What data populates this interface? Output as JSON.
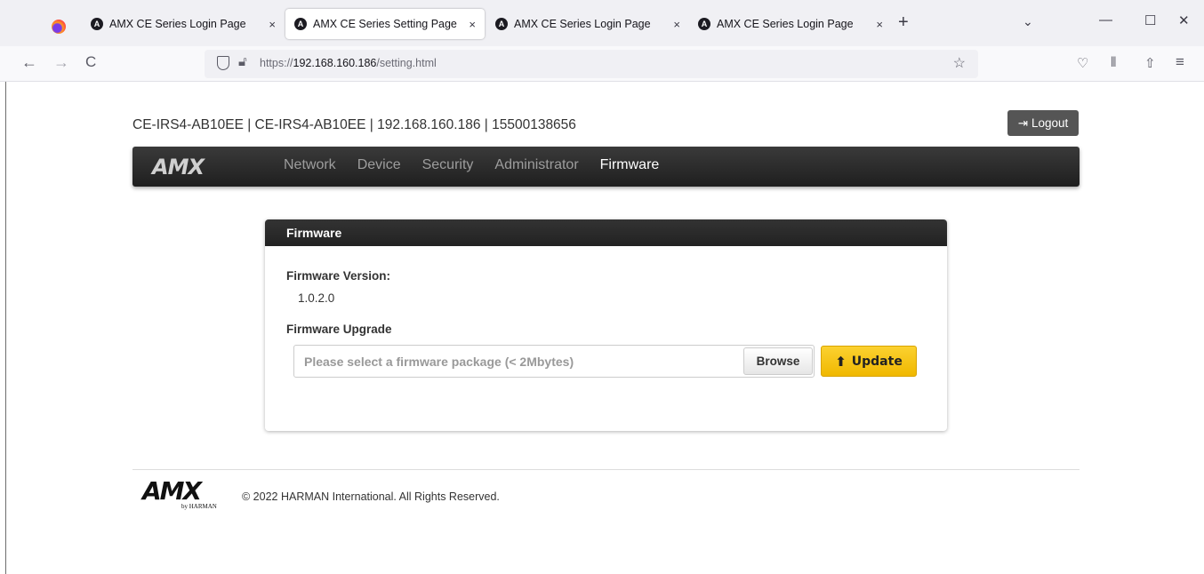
{
  "browser": {
    "tabs": [
      {
        "label": "AMX CE Series Login Page",
        "close": "×"
      },
      {
        "label": "AMX CE Series Setting Page",
        "close": "×"
      },
      {
        "label": "AMX CE Series Login Page",
        "close": "×"
      },
      {
        "label": "AMX CE Series Login Page",
        "close": "×"
      }
    ],
    "new_tab": "+",
    "tab_list": "⌄",
    "window_controls": {
      "minimize": "—",
      "maximize": "☐",
      "close": "✕"
    },
    "nav": {
      "back": "←",
      "forward": "→",
      "reload": "C"
    },
    "url_prefix": "https://",
    "url_host": "192.168.160.186",
    "url_path": "/setting.html",
    "star": "☆",
    "toolbar_icons": {
      "pocket": "♡",
      "library": "⫴",
      "share": "⇧",
      "menu": "≡"
    }
  },
  "header": {
    "device_info": "CE-IRS4-AB10EE | CE-IRS4-AB10EE | 192.168.160.186 | 15500138656",
    "logout_label": "Logout",
    "logout_icon": "⇥"
  },
  "nav": {
    "brand": "AMX",
    "items": [
      "Network",
      "Device",
      "Security",
      "Administrator",
      "Firmware"
    ],
    "active": "Firmware"
  },
  "panel": {
    "title": "Firmware",
    "version_label": "Firmware Version:",
    "version_value": "1.0.2.0",
    "upgrade_label": "Firmware Upgrade",
    "file_placeholder": "Please select a firmware package (< 2Mbytes)",
    "browse_label": "Browse",
    "update_label": "Update",
    "update_icon": "⬆"
  },
  "footer": {
    "logo_text": "AMX",
    "logo_sub": "by HARMAN",
    "copyright": "© 2022 HARMAN International. All Rights Reserved."
  },
  "colors": {
    "nav_bg": "#2b2b2b",
    "update_btn": "#f7c11b",
    "logout_btn": "#555555"
  }
}
